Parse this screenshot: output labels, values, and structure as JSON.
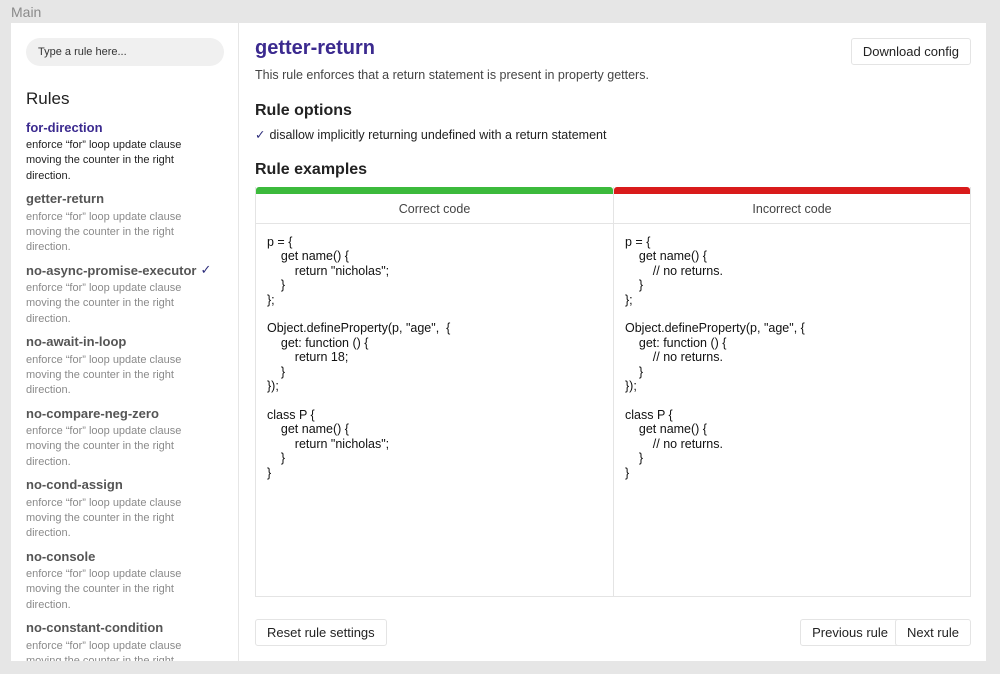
{
  "frame": {
    "label": "Main"
  },
  "sidebar": {
    "search_placeholder": "Type a rule here...",
    "heading": "Rules",
    "items": [
      {
        "name": "for-direction",
        "desc": "enforce “for” loop update clause moving the counter in the right direction.",
        "active": true,
        "checked": false
      },
      {
        "name": "getter-return",
        "desc": "enforce “for” loop update clause moving the counter in the right direction.",
        "active": false,
        "checked": false
      },
      {
        "name": "no-async-promise-executor",
        "desc": "enforce “for” loop update clause moving the counter in the right direction.",
        "active": false,
        "checked": true
      },
      {
        "name": "no-await-in-loop",
        "desc": "enforce “for” loop update clause moving the counter in the right direction.",
        "active": false,
        "checked": false
      },
      {
        "name": "no-compare-neg-zero",
        "desc": "enforce “for” loop update clause moving the counter in the right direction.",
        "active": false,
        "checked": false
      },
      {
        "name": "no-cond-assign",
        "desc": "enforce “for” loop update clause moving the counter in the right direction.",
        "active": false,
        "checked": false
      },
      {
        "name": "no-console",
        "desc": "enforce “for” loop update clause moving the counter in the right direction.",
        "active": false,
        "checked": false
      },
      {
        "name": "no-constant-condition",
        "desc": "enforce “for” loop update clause moving the counter in the right direction.",
        "active": false,
        "checked": false
      }
    ]
  },
  "main": {
    "title": "getter-return",
    "summary": "This rule enforces that a return statement is present in property getters.",
    "download_label": "Download config",
    "options_heading": "Rule options",
    "option_text": "disallow implicitly returning undefined with a return statement",
    "examples_heading": "Rule examples",
    "correct_label": "Correct code",
    "incorrect_label": "Incorrect code",
    "correct_code": "p = {\n    get name() {\n        return \"nicholas\";\n    }\n};\n\nObject.defineProperty(p, \"age\",  {\n    get: function () {\n        return 18;\n    }\n});\n\nclass P {\n    get name() {\n        return \"nicholas\";\n    }\n}",
    "incorrect_code": "p = {\n    get name() {\n        // no returns.\n    }\n};\n\nObject.defineProperty(p, \"age\", {\n    get: function () {\n        // no returns.\n    }\n});\n\nclass P {\n    get name() {\n        // no returns.\n    }\n}",
    "reset_label": "Reset rule settings",
    "prev_label": "Previous rule",
    "next_label": "Next rule"
  },
  "colors": {
    "accent": "#3b2a8f",
    "correct": "#3cba3c",
    "incorrect": "#d91b1b"
  }
}
